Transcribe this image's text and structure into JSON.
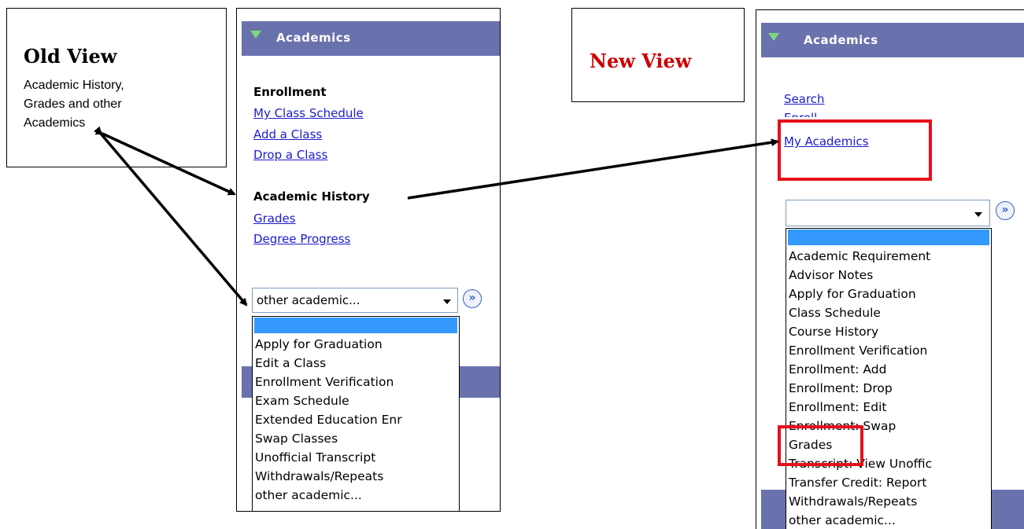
{
  "old_view": {
    "callout_title": "Old View",
    "callout_lines": [
      "Academic History,",
      "Grades and other",
      "Academics"
    ],
    "panel_title": "Academics",
    "enrollment_heading": "Enrollment",
    "enrollment_links": [
      "My Class Schedule",
      "Add a Class",
      "Drop a Class"
    ],
    "history_heading": "Academic History",
    "history_links": [
      "Grades",
      "Degree Progress"
    ],
    "select_value": "other academic...",
    "dropdown_options": [
      "Apply for Graduation",
      "Edit a Class",
      "Enrollment Verification",
      "Exam Schedule",
      "Extended Education Enr",
      "Swap Classes",
      "Unofficial Transcript",
      "Withdrawals/Repeats",
      "other academic..."
    ]
  },
  "new_view": {
    "callout_title": "New View",
    "panel_title": "Academics",
    "links": [
      "Search",
      "Enroll",
      "My Academics"
    ],
    "select_value": "",
    "dropdown_options": [
      "Academic Requirement",
      "Advisor Notes",
      "Apply for Graduation",
      "Class Schedule",
      "Course History",
      "Enrollment Verification",
      "Enrollment: Add",
      "Enrollment: Drop",
      "Enrollment: Edit",
      "Enrollment: Swap",
      "Grades",
      "Transcript: View Unoffic",
      "Transfer Credit: Report",
      "Withdrawals/Repeats",
      "other academic..."
    ]
  },
  "colors": {
    "header_bg": "#6a72ad",
    "link": "#1c1ccc",
    "highlight": "#3399ff",
    "red_box": "#e5101a",
    "new_view_title": "#cc0000"
  },
  "icons": [
    "expand-triangle-icon",
    "go-arrow-icon",
    "dropdown-caret-icon"
  ]
}
